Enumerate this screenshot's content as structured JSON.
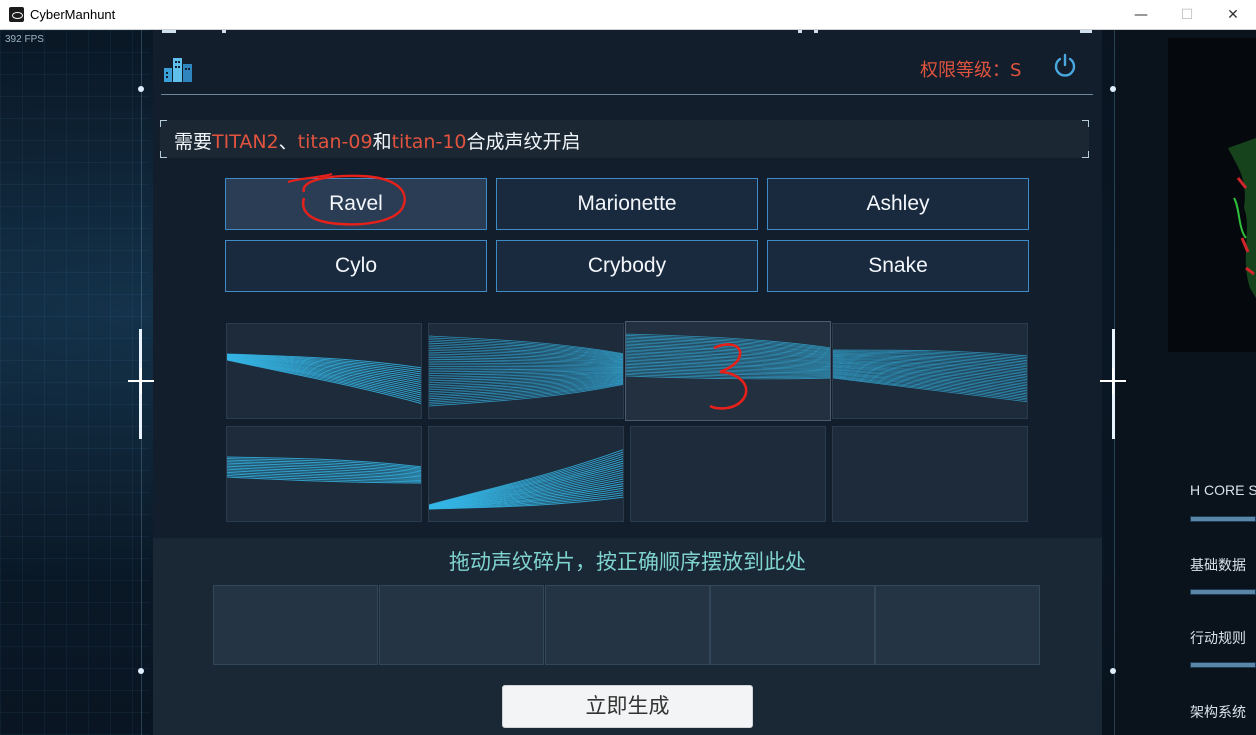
{
  "window": {
    "title": "CyberManhunt",
    "minimize_glyph": "—",
    "maximize_glyph": "☐",
    "close_glyph": "✕"
  },
  "overlay": {
    "fps": "392 FPS"
  },
  "header": {
    "authority_label": "权限等级：S",
    "logo_icon": "building-cube-icon",
    "power_icon": "power-icon"
  },
  "instruction": {
    "prefix": "需要",
    "t1": "TITAN2",
    "sep1": "、",
    "t2": "titan-09",
    "sep2": "和",
    "t3": "titan-10",
    "suffix": "合成声纹开启"
  },
  "names": [
    {
      "label": "Ravel",
      "selected": true
    },
    {
      "label": "Marionette",
      "selected": false
    },
    {
      "label": "Ashley",
      "selected": false
    },
    {
      "label": "Cylo",
      "selected": false
    },
    {
      "label": "Crybody",
      "selected": false
    },
    {
      "label": "Snake",
      "selected": false
    }
  ],
  "fragments_count_filled": 6,
  "drop_zone": {
    "title": "拖动声纹碎片，按正确顺序摆放到此处",
    "slot_count": 5
  },
  "generate_button": "立即生成",
  "right_panel": {
    "labels": [
      "H CORE S",
      "基础数据",
      "行动规则",
      "架构系统"
    ]
  },
  "annotations": {
    "number_mark": "3",
    "color": "#e8201a"
  },
  "colors": {
    "accent_red": "#e0533e",
    "button_border": "#3f8bc6",
    "wave": "#35b6e6",
    "drop_title": "#7fd3cf"
  }
}
